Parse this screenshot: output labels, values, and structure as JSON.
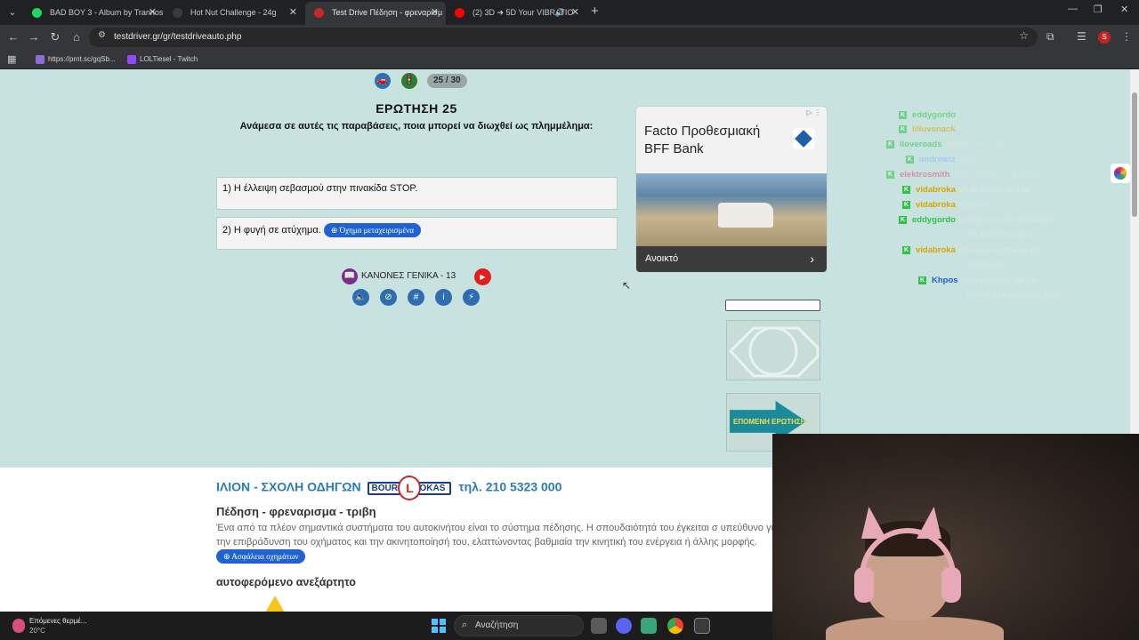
{
  "browser": {
    "tabs": [
      {
        "title": "BAD BOY 3 - Album by Trannos",
        "favicon_color": "#1ed760",
        "active": false
      },
      {
        "title": "Hot Nut Challenge - 24g",
        "favicon_color": "#3a3a3a",
        "active": false
      },
      {
        "title": "Test Drive Πέδηση - φρεναρισμ",
        "favicon_color": "#c62828",
        "active": true
      },
      {
        "title": "(2) 3D ➜ 5D Your VIBRATIO",
        "favicon_color": "#ff0000",
        "active": false
      }
    ],
    "url": "testdriver.gr/gr/testdriveauto.php",
    "bookmarks": [
      {
        "label": "https://prnt.sc/gqSb...",
        "color": "#8e6bd6"
      },
      {
        "label": "LOLTiesel - Twitch",
        "color": "#9146ff"
      }
    ],
    "profile_initial": "S"
  },
  "quiz": {
    "counter": "25 / 30",
    "title": "ΕΡΩΤΗΣΗ  25",
    "question": "Ανάμεσα σε αυτές τις παραβάσεις, ποια μπορεί να διωχθεί ως πλημμέλημα:",
    "answers": [
      {
        "text": "1) Η έλλειψη σεβασμού στην πινακίδα STOP.",
        "tag": ""
      },
      {
        "text": "2) Η φυγή σε ατύχημα.",
        "tag": "⊕ Όχημα μεταχειρισμένα"
      }
    ],
    "rules_label": "ΚΑΝΟΝΕΣ ΓΕΝΙΚΑ  -  13",
    "next_label": "ΕΠΟΜΕΝΗ ΕΡΩΤΗΣΗ"
  },
  "ad": {
    "title": "Facto Προθεσμιακή BFF Bank",
    "cta": "Ανοικτό",
    "badge": "▷ ⋮"
  },
  "chat": [
    {
      "user": "eddygordo",
      "color": "#2ec24a",
      "msg": "μπορεις να την σκιπαρεις",
      "msg2": "για το τελος αμεα"
    },
    {
      "user": "vidabroka",
      "color": "#d9a400",
      "msg": "den exei noima na tin",
      "msg2": "skippareis"
    },
    {
      "user": "Khpos",
      "color": "#1f5fd6",
      "msg": "ητον ευκαιρια να την",
      "msg2": "μαθεις την ερωτηση αλλα"
    },
    {
      "user": "vidabroka",
      "color": "#d9a400",
      "msg": "mi to kaneis etsi re",
      "msg2": ""
    },
    {
      "user": "vidabroka",
      "color": "#d9a400",
      "msg": "sigita fill",
      "msg2": ""
    },
    {
      "user": "andrewiz",
      "color": "#7fb8ff",
      "msg": "piperi",
      "msg2": ""
    },
    {
      "user": "iloveroads",
      "color": "#2ec24a",
      "msg": "παιδια ειναι αυτο",
      "msg2": ""
    },
    {
      "user": "elektrosmith",
      "color": "#d84a8c",
      "msg": "Ειναι μακρια το δίπλωμα",
      "msg2": ""
    },
    {
      "user": "lilluvsnack",
      "color": "#d9a400",
      "msg": "?",
      "msg2": ""
    },
    {
      "user": "eddygordo",
      "color": "#2ec24a",
      "msg": "",
      "msg2": ""
    }
  ],
  "lower": {
    "school_left": "ΙΛΙΟΝ - ΣΧΟΛΗ ΟΔΗΓΩΝ",
    "logo_left": "BOUR",
    "logo_mid": "L",
    "logo_right": "OKAS",
    "school_right": "τηλ. 210 5323 000",
    "heading": "Πέδηση - φρεναρισμα - τριβη",
    "paragraph": "Ένα από τα πλέον σημαντικά συστήματα του αυτοκινήτου είναι το σύστημα πέδησης. Η σπουδαιότητά του έγκειται σ υπεύθυνο για την επιβράδυνση του οχήματος και την ακινητοποίησή του, ελαττώνοντας βαθμιαία την κινητική του ενέργεια ή άλλης μορφής.",
    "tag": "⊕ Ασφάλεια οχημάτων",
    "subheading": "αυτοφερόμενο ανεξάρτητο"
  },
  "taskbar": {
    "weather_line1": "Επόμενες θερμέ...",
    "weather_line2": "20°C",
    "search": "Αναζήτηση"
  }
}
